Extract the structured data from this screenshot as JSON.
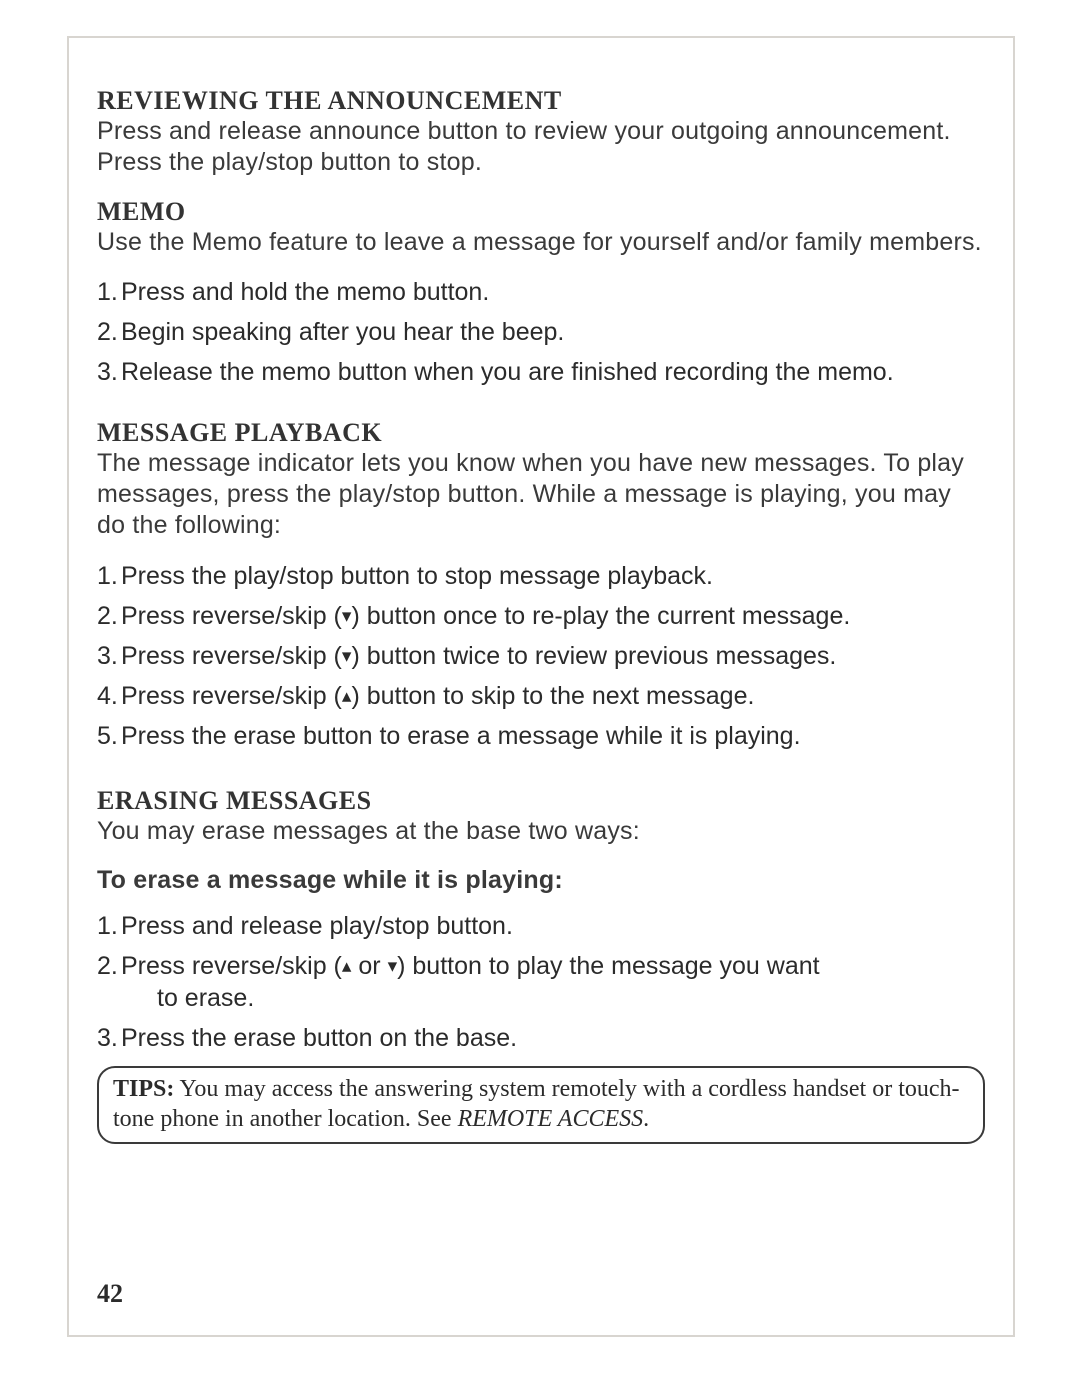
{
  "sections": {
    "review": {
      "heading": "REVIEWING THE ANNOUNCEMENT",
      "body": "Press and release announce button to review your outgoing announcement. Press the play/stop button to stop."
    },
    "memo": {
      "heading": "MEMO",
      "body": "Use the Memo feature to leave a message for yourself and/or family members.",
      "items": [
        "Press and hold the memo button.",
        "Begin speaking after you hear the beep.",
        "Release the memo button when you are finished recording the memo."
      ]
    },
    "playback": {
      "heading": "MESSAGE PLAYBACK",
      "body": "The message indicator lets you know when you have new messages. To play messages, press the play/stop button. While a message is playing, you may do the following:",
      "items": [
        {
          "before": "Press the play/stop button to stop message playback.",
          "icon": "",
          "after": ""
        },
        {
          "before": "Press reverse/skip (",
          "icon": "▾",
          "after": ") button once to re-play the current message."
        },
        {
          "before": "Press reverse/skip (",
          "icon": "▾",
          "after": ") button twice to review previous messages."
        },
        {
          "before": "Press reverse/skip (",
          "icon": "▴",
          "after": ") button to skip to the next message."
        },
        {
          "before": "Press the erase button to erase a message while it is playing.",
          "icon": "",
          "after": ""
        }
      ]
    },
    "erasing": {
      "heading": "ERASING MESSAGES",
      "body": "You may erase messages at the base two ways:",
      "sub_heading": "To erase a message while it is playing:",
      "items": [
        {
          "before": "Press and release play/stop button.",
          "icon1": "",
          "middle": "",
          "icon2": "",
          "after": "",
          "line2": ""
        },
        {
          "before": "Press reverse/skip (",
          "icon1": "▴",
          "middle": " or ",
          "icon2": "▾",
          "after": ") button to play the message you want",
          "line2": "to erase."
        },
        {
          "before": "Press the erase button on the base.",
          "icon1": "",
          "middle": "",
          "icon2": "",
          "after": "",
          "line2": ""
        }
      ]
    },
    "tips": {
      "label": "TIPS:",
      "body_before": " You may access the answering system remotely with a cordless handset or touch-tone phone in another location. See ",
      "ref": "REMOTE ACCESS",
      "body_after": "."
    }
  },
  "page_number": "42"
}
